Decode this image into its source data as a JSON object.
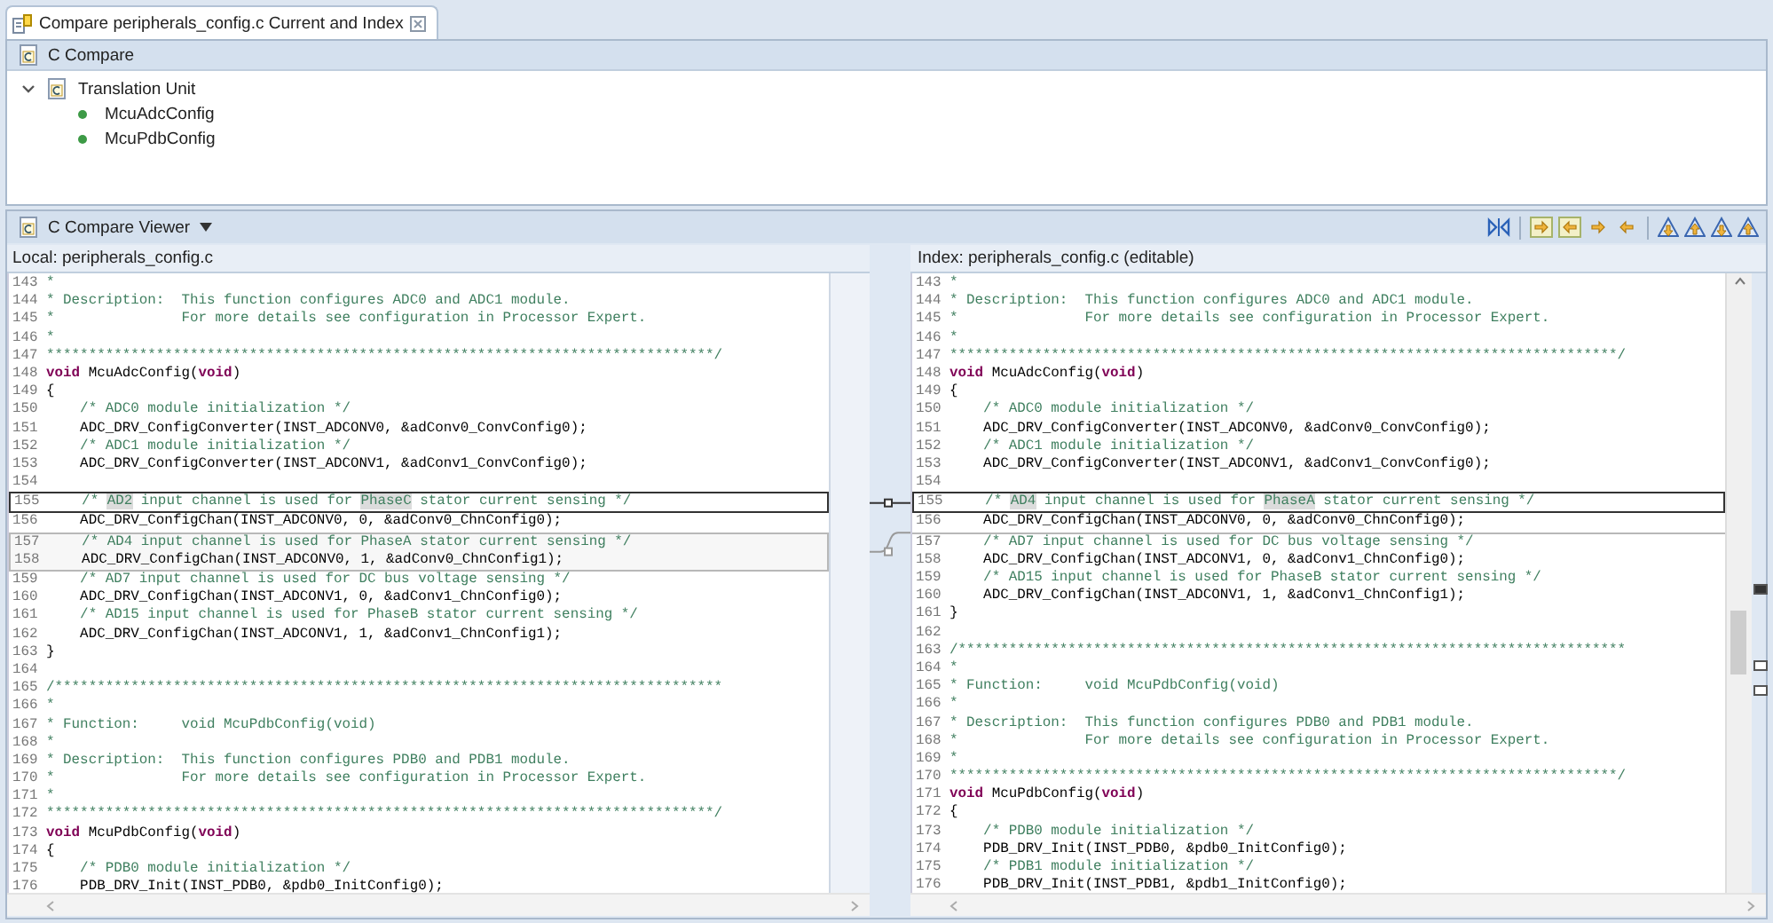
{
  "tab": {
    "title": "Compare peripherals_config.c Current and Index",
    "selected": true
  },
  "compare_panel": {
    "title": "C Compare",
    "tree": [
      {
        "label": "Translation Unit",
        "expanded": true,
        "children": [
          {
            "label": "McuAdcConfig"
          },
          {
            "label": "McuPdbConfig"
          }
        ]
      }
    ]
  },
  "compare_viewer": {
    "title": "C Compare Viewer",
    "left_pane": {
      "title": "Local: peripherals_config.c",
      "blocks": [
        {
          "kind": "same",
          "lines": [
            {
              "num": "143",
              "segments": [
                {
                  "kind": "comment",
                  "text": "*"
                }
              ]
            },
            {
              "num": "144",
              "segments": [
                {
                  "kind": "comment",
                  "text": "* Description:  This function configures ADC0 and ADC1 module."
                }
              ]
            },
            {
              "num": "145",
              "segments": [
                {
                  "kind": "comment",
                  "text": "*               For more details see configuration in Processor Expert."
                }
              ]
            },
            {
              "num": "146",
              "segments": [
                {
                  "kind": "comment",
                  "text": "*"
                }
              ]
            },
            {
              "num": "147",
              "segments": [
                {
                  "kind": "comment",
                  "text": "*******************************************************************************/"
                }
              ]
            },
            {
              "num": "148",
              "segments": [
                {
                  "kind": "keyword",
                  "text": "void"
                },
                {
                  "kind": "plain",
                  "text": " McuAdcConfig("
                },
                {
                  "kind": "keyword",
                  "text": "void"
                },
                {
                  "kind": "plain",
                  "text": ")"
                }
              ]
            },
            {
              "num": "149",
              "segments": [
                {
                  "kind": "plain",
                  "text": "{"
                }
              ]
            },
            {
              "num": "150",
              "segments": [
                {
                  "kind": "comment",
                  "text": "    /* ADC0 module initialization */"
                }
              ]
            },
            {
              "num": "151",
              "segments": [
                {
                  "kind": "plain",
                  "text": "    ADC_DRV_ConfigConverter(INST_ADCONV0, &adConv0_ConvConfig0);"
                }
              ]
            },
            {
              "num": "152",
              "segments": [
                {
                  "kind": "comment",
                  "text": "    /* ADC1 module initialization */"
                }
              ]
            },
            {
              "num": "153",
              "segments": [
                {
                  "kind": "plain",
                  "text": "    ADC_DRV_ConfigConverter(INST_ADCONV1, &adConv1_ConvConfig0);"
                }
              ]
            },
            {
              "num": "154"
            }
          ]
        },
        {
          "kind": "change",
          "selected": true,
          "lines": [
            {
              "num": "155",
              "segments": [
                {
                  "kind": "comment",
                  "text": "    /* "
                },
                {
                  "kind": "changed",
                  "text": "AD2"
                },
                {
                  "kind": "comment",
                  "text": " input channel is used for "
                },
                {
                  "kind": "changed",
                  "text": "PhaseC"
                },
                {
                  "kind": "comment",
                  "text": " stator current sensing */"
                }
              ]
            }
          ]
        },
        {
          "kind": "same",
          "lines": [
            {
              "num": "156",
              "segments": [
                {
                  "kind": "plain",
                  "text": "    ADC_DRV_ConfigChan(INST_ADCONV0, 0, &adConv0_ChnConfig0);"
                }
              ]
            }
          ]
        },
        {
          "kind": "change",
          "selected": false,
          "lines": [
            {
              "num": "157",
              "segments": [
                {
                  "kind": "comment",
                  "text": "    /* AD4 input channel is used for PhaseA stator current sensing */"
                }
              ]
            },
            {
              "num": "158",
              "segments": [
                {
                  "kind": "plain",
                  "text": "    ADC_DRV_ConfigChan(INST_ADCONV0, 1, &adConv0_ChnConfig1);"
                }
              ]
            }
          ]
        },
        {
          "kind": "same",
          "lines": [
            {
              "num": "159",
              "segments": [
                {
                  "kind": "comment",
                  "text": "    /* AD7 input channel is used for DC bus voltage sensing */"
                }
              ]
            },
            {
              "num": "160",
              "segments": [
                {
                  "kind": "plain",
                  "text": "    ADC_DRV_ConfigChan(INST_ADCONV1, 0, &adConv1_ChnConfig0);"
                }
              ]
            },
            {
              "num": "161",
              "segments": [
                {
                  "kind": "comment",
                  "text": "    /* AD15 input channel is used for PhaseB stator current sensing */"
                }
              ]
            },
            {
              "num": "162",
              "segments": [
                {
                  "kind": "plain",
                  "text": "    ADC_DRV_ConfigChan(INST_ADCONV1, 1, &adConv1_ChnConfig1);"
                }
              ]
            },
            {
              "num": "163",
              "segments": [
                {
                  "kind": "plain",
                  "text": "}"
                }
              ]
            },
            {
              "num": "164"
            },
            {
              "num": "165",
              "segments": [
                {
                  "kind": "comment",
                  "text": "/*******************************************************************************"
                }
              ]
            },
            {
              "num": "166",
              "segments": [
                {
                  "kind": "comment",
                  "text": "*"
                }
              ]
            },
            {
              "num": "167",
              "segments": [
                {
                  "kind": "comment",
                  "text": "* Function:     void McuPdbConfig(void)"
                }
              ]
            },
            {
              "num": "168",
              "segments": [
                {
                  "kind": "comment",
                  "text": "*"
                }
              ]
            },
            {
              "num": "169",
              "segments": [
                {
                  "kind": "comment",
                  "text": "* Description:  This function configures PDB0 and PDB1 module."
                }
              ]
            },
            {
              "num": "170",
              "segments": [
                {
                  "kind": "comment",
                  "text": "*               For more details see configuration in Processor Expert."
                }
              ]
            },
            {
              "num": "171",
              "segments": [
                {
                  "kind": "comment",
                  "text": "*"
                }
              ]
            },
            {
              "num": "172",
              "segments": [
                {
                  "kind": "comment",
                  "text": "*******************************************************************************/"
                }
              ]
            },
            {
              "num": "173",
              "segments": [
                {
                  "kind": "keyword",
                  "text": "void"
                },
                {
                  "kind": "plain",
                  "text": " McuPdbConfig("
                },
                {
                  "kind": "keyword",
                  "text": "void"
                },
                {
                  "kind": "plain",
                  "text": ")"
                }
              ]
            },
            {
              "num": "174",
              "segments": [
                {
                  "kind": "plain",
                  "text": "{"
                }
              ]
            },
            {
              "num": "175",
              "segments": [
                {
                  "kind": "comment",
                  "text": "    /* PDB0 module initialization */"
                }
              ]
            },
            {
              "num": "176",
              "segments": [
                {
                  "kind": "plain",
                  "text": "    PDB_DRV_Init(INST_PDB0, &pdb0_InitConfig0);"
                }
              ]
            }
          ]
        }
      ]
    },
    "right_pane": {
      "title": "Index: peripherals_config.c (editable)",
      "blocks": [
        {
          "kind": "same",
          "lines": [
            {
              "num": "143",
              "segments": [
                {
                  "kind": "comment",
                  "text": "*"
                }
              ]
            },
            {
              "num": "144",
              "segments": [
                {
                  "kind": "comment",
                  "text": "* Description:  This function configures ADC0 and ADC1 module."
                }
              ]
            },
            {
              "num": "145",
              "segments": [
                {
                  "kind": "comment",
                  "text": "*               For more details see configuration in Processor Expert."
                }
              ]
            },
            {
              "num": "146",
              "segments": [
                {
                  "kind": "comment",
                  "text": "*"
                }
              ]
            },
            {
              "num": "147",
              "segments": [
                {
                  "kind": "comment",
                  "text": "*******************************************************************************/"
                }
              ]
            },
            {
              "num": "148",
              "segments": [
                {
                  "kind": "keyword",
                  "text": "void"
                },
                {
                  "kind": "plain",
                  "text": " McuAdcConfig("
                },
                {
                  "kind": "keyword",
                  "text": "void"
                },
                {
                  "kind": "plain",
                  "text": ")"
                }
              ]
            },
            {
              "num": "149",
              "segments": [
                {
                  "kind": "plain",
                  "text": "{"
                }
              ]
            },
            {
              "num": "150",
              "segments": [
                {
                  "kind": "comment",
                  "text": "    /* ADC0 module initialization */"
                }
              ]
            },
            {
              "num": "151",
              "segments": [
                {
                  "kind": "plain",
                  "text": "    ADC_DRV_ConfigConverter(INST_ADCONV0, &adConv0_ConvConfig0);"
                }
              ]
            },
            {
              "num": "152",
              "segments": [
                {
                  "kind": "comment",
                  "text": "    /* ADC1 module initialization */"
                }
              ]
            },
            {
              "num": "153",
              "segments": [
                {
                  "kind": "plain",
                  "text": "    ADC_DRV_ConfigConverter(INST_ADCONV1, &adConv1_ConvConfig0);"
                }
              ]
            },
            {
              "num": "154"
            }
          ]
        },
        {
          "kind": "change",
          "selected": true,
          "lines": [
            {
              "num": "155",
              "segments": [
                {
                  "kind": "comment",
                  "text": "    /* "
                },
                {
                  "kind": "changed",
                  "text": "AD4"
                },
                {
                  "kind": "comment",
                  "text": " input channel is used for "
                },
                {
                  "kind": "changed",
                  "text": "PhaseA"
                },
                {
                  "kind": "comment",
                  "text": " stator current sensing */"
                }
              ]
            }
          ]
        },
        {
          "kind": "same",
          "lines": [
            {
              "num": "156",
              "segments": [
                {
                  "kind": "plain",
                  "text": "    ADC_DRV_ConfigChan(INST_ADCONV0, 0, &adConv0_ChnConfig0);"
                }
              ]
            }
          ]
        },
        {
          "kind": "change",
          "selected": false
        },
        {
          "kind": "same",
          "lines": [
            {
              "num": "157",
              "segments": [
                {
                  "kind": "comment",
                  "text": "    /* AD7 input channel is used for DC bus voltage sensing */"
                }
              ]
            },
            {
              "num": "158",
              "segments": [
                {
                  "kind": "plain",
                  "text": "    ADC_DRV_ConfigChan(INST_ADCONV1, 0, &adConv1_ChnConfig0);"
                }
              ]
            },
            {
              "num": "159",
              "segments": [
                {
                  "kind": "comment",
                  "text": "    /* AD15 input channel is used for PhaseB stator current sensing */"
                }
              ]
            },
            {
              "num": "160",
              "segments": [
                {
                  "kind": "plain",
                  "text": "    ADC_DRV_ConfigChan(INST_ADCONV1, 1, &adConv1_ChnConfig1);"
                }
              ]
            },
            {
              "num": "161",
              "segments": [
                {
                  "kind": "plain",
                  "text": "}"
                }
              ]
            },
            {
              "num": "162"
            },
            {
              "num": "163",
              "segments": [
                {
                  "kind": "comment",
                  "text": "/*******************************************************************************"
                }
              ]
            },
            {
              "num": "164",
              "segments": [
                {
                  "kind": "comment",
                  "text": "*"
                }
              ]
            },
            {
              "num": "165",
              "segments": [
                {
                  "kind": "comment",
                  "text": "* Function:     void McuPdbConfig(void)"
                }
              ]
            },
            {
              "num": "166",
              "segments": [
                {
                  "kind": "comment",
                  "text": "*"
                }
              ]
            },
            {
              "num": "167",
              "segments": [
                {
                  "kind": "comment",
                  "text": "* Description:  This function configures PDB0 and PDB1 module."
                }
              ]
            },
            {
              "num": "168",
              "segments": [
                {
                  "kind": "comment",
                  "text": "*               For more details see configuration in Processor Expert."
                }
              ]
            },
            {
              "num": "169",
              "segments": [
                {
                  "kind": "comment",
                  "text": "*"
                }
              ]
            },
            {
              "num": "170",
              "segments": [
                {
                  "kind": "comment",
                  "text": "*******************************************************************************/"
                }
              ]
            },
            {
              "num": "171",
              "segments": [
                {
                  "kind": "keyword",
                  "text": "void"
                },
                {
                  "kind": "plain",
                  "text": " McuPdbConfig("
                },
                {
                  "kind": "keyword",
                  "text": "void"
                },
                {
                  "kind": "plain",
                  "text": ")"
                }
              ]
            },
            {
              "num": "172",
              "segments": [
                {
                  "kind": "plain",
                  "text": "{"
                }
              ]
            },
            {
              "num": "173",
              "segments": [
                {
                  "kind": "comment",
                  "text": "    /* PDB0 module initialization */"
                }
              ]
            },
            {
              "num": "174",
              "segments": [
                {
                  "kind": "plain",
                  "text": "    PDB_DRV_Init(INST_PDB0, &pdb0_InitConfig0);"
                }
              ]
            },
            {
              "num": "175",
              "segments": [
                {
                  "kind": "comment",
                  "text": "    /* PDB1 module initialization */"
                }
              ]
            },
            {
              "num": "176",
              "segments": [
                {
                  "kind": "plain",
                  "text": "    PDB_DRV_Init(INST_PDB1, &pdb1_InitConfig0);"
                }
              ]
            }
          ]
        }
      ]
    }
  }
}
